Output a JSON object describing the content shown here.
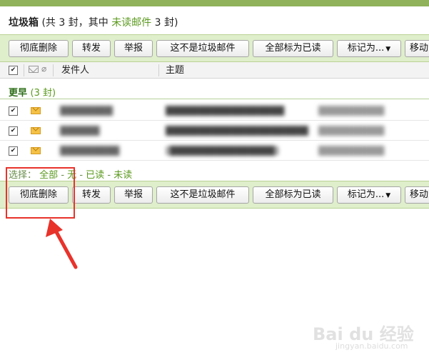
{
  "header": {
    "folder_name": "垃圾箱",
    "count_prefix": "(共 3 封，其中 ",
    "unread_link": "未读邮件",
    "count_suffix": " 3 封)"
  },
  "toolbar": {
    "delete_forever": "彻底删除",
    "forward": "转发",
    "report": "举报",
    "not_spam": "这不是垃圾邮件",
    "mark_all_read": "全部标为已读",
    "mark_as": "标记为...",
    "move_to": "移动到"
  },
  "columns": {
    "sender": "发件人",
    "subject": "主题"
  },
  "group": {
    "label": "更早",
    "count": "(3 封)"
  },
  "mails": [
    {
      "sender": "████████",
      "subject": "██████████████████",
      "date": "██████████"
    },
    {
      "sender": "██████",
      "subject": "████████████████████████",
      "date": "██████████"
    },
    {
      "sender": "█████████",
      "subject": "[████████████████]",
      "date": "██████████"
    }
  ],
  "select_bar": {
    "label": "选择：",
    "all": "全部",
    "none": "无",
    "read": "已读",
    "unread": "未读",
    "dash": "-"
  },
  "watermark": {
    "text": "Bai du 经验",
    "sub": "jingyan.baidu.com"
  },
  "colors": {
    "accent_green": "#8fb25a",
    "toolbar_bg": "#dfeecb",
    "link_green": "#5b9a1e",
    "annotation_red": "#e8332b"
  }
}
